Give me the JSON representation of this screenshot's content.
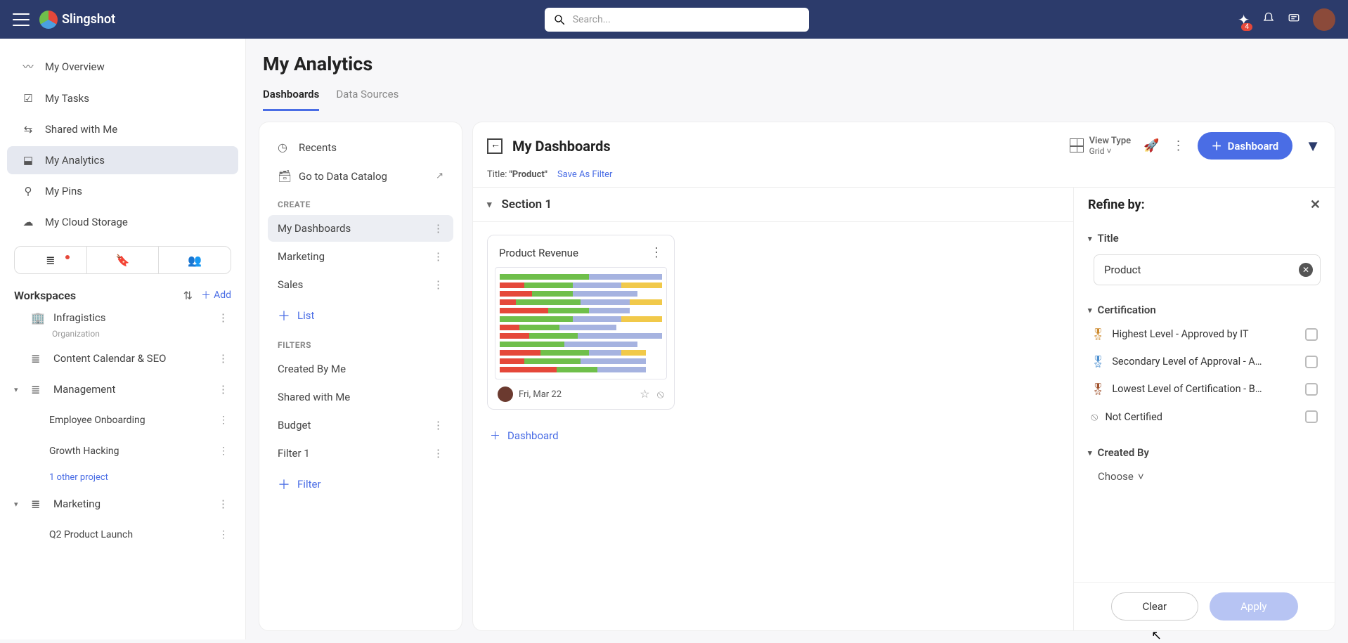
{
  "brand": "Slingshot",
  "search": {
    "placeholder": "Search..."
  },
  "notifications_badge": "4",
  "nav": {
    "overview": "My Overview",
    "tasks": "My Tasks",
    "shared": "Shared with Me",
    "analytics": "My Analytics",
    "pins": "My Pins",
    "cloud": "My Cloud Storage"
  },
  "workspaces_label": "Workspaces",
  "add_label": "Add",
  "workspaces": {
    "infragistics": {
      "name": "Infragistics",
      "sub": "Organization"
    },
    "content_cal": "Content Calendar & SEO",
    "management": {
      "name": "Management",
      "children": [
        "Employee Onboarding",
        "Growth Hacking"
      ],
      "other": "1 other project"
    },
    "marketing": {
      "name": "Marketing",
      "children": [
        "Q2 Product Launch"
      ]
    }
  },
  "page": {
    "title": "My Analytics",
    "tabs": [
      "Dashboards",
      "Data Sources"
    ]
  },
  "list_panel": {
    "recents": "Recents",
    "catalog": "Go to Data Catalog",
    "create_head": "CREATE",
    "items": [
      "My Dashboards",
      "Marketing",
      "Sales"
    ],
    "add_list": "List",
    "filters_head": "FILTERS",
    "filter_items": [
      "Created By Me",
      "Shared with Me",
      "Budget",
      "Filter 1"
    ],
    "add_filter": "Filter"
  },
  "content": {
    "title": "My Dashboards",
    "viewtype_label": "View Type",
    "viewtype_value": "Grid",
    "dashboard_btn": "Dashboard",
    "filter_row": {
      "label": "Title:",
      "value": "\"Product\"",
      "save": "Save As Filter"
    },
    "section1": "Section 1",
    "card": {
      "title": "Product Revenue",
      "date": "Fri, Mar 22"
    },
    "add_dashboard": "Dashboard"
  },
  "refine": {
    "title": "Refine by:",
    "group_title": "Title",
    "title_value": "Product",
    "group_cert": "Certification",
    "cert_options": [
      "Highest Level - Approved by IT",
      "Secondary Level of Approval - A…",
      "Lowest Level of Certification - B…",
      "Not Certified"
    ],
    "group_created": "Created By",
    "choose": "Choose",
    "clear_btn": "Clear",
    "apply_btn": "Apply"
  }
}
